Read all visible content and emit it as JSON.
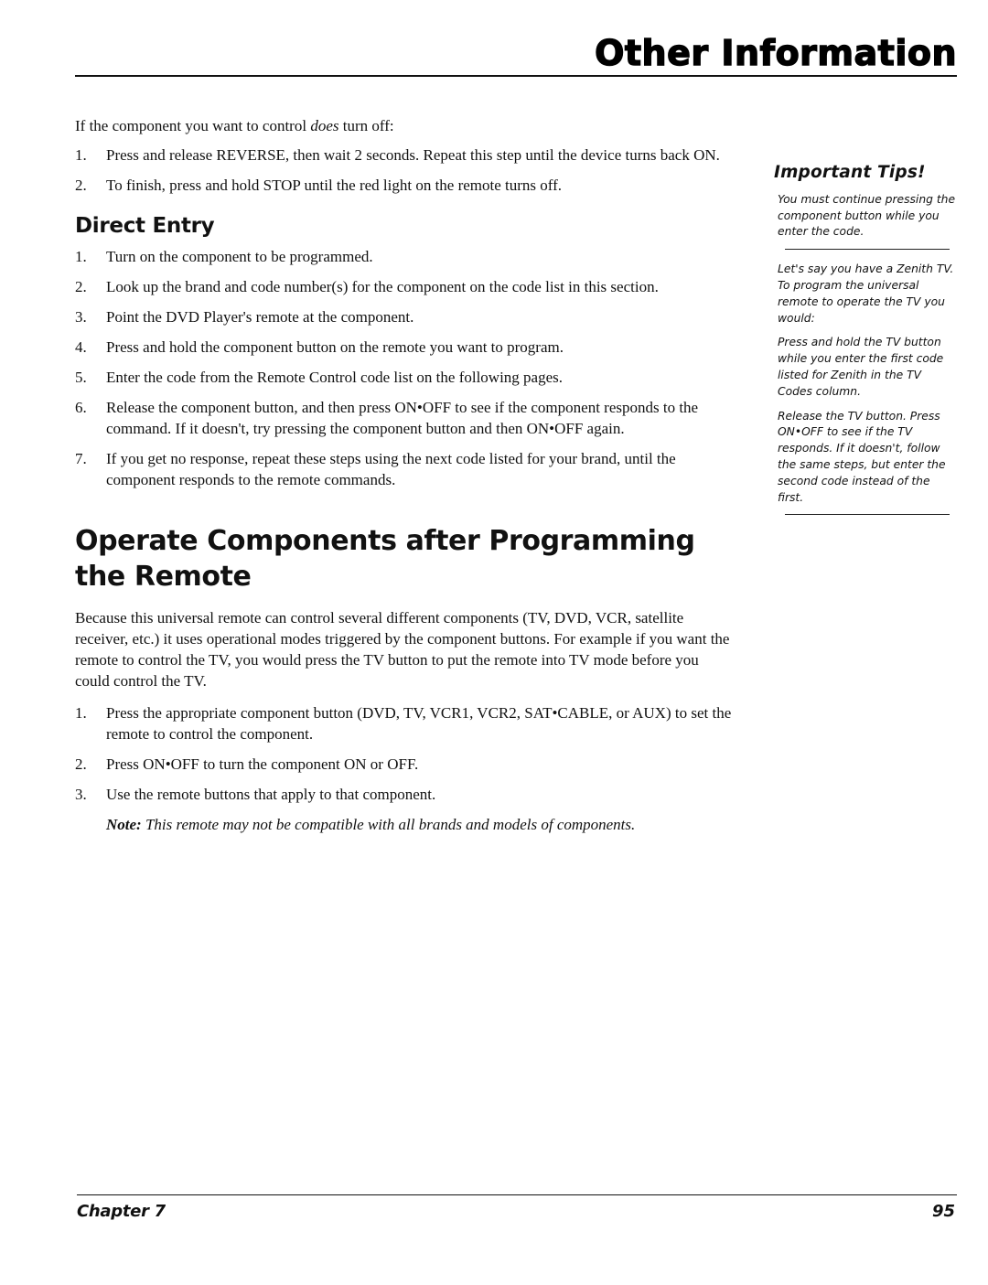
{
  "header": {
    "title": "Other Information"
  },
  "main": {
    "intro": {
      "before": "If the component you want to control ",
      "emphasis": "does",
      "after": " turn off:"
    },
    "turn_off_steps": [
      {
        "num": "1.",
        "text": "Press and release REVERSE, then wait 2 seconds. Repeat this step until the device turns back ON."
      },
      {
        "num": "2.",
        "text": "To finish, press and hold STOP until the red light on the remote turns off."
      }
    ],
    "direct_entry": {
      "heading": "Direct Entry",
      "steps": [
        {
          "num": "1.",
          "text": "Turn on the component to be programmed."
        },
        {
          "num": "2.",
          "text": "Look up the brand and code number(s) for the component on the code list in this section."
        },
        {
          "num": "3.",
          "text": "Point the DVD Player's remote at the component."
        },
        {
          "num": "4.",
          "text": "Press and hold the component button on the remote you want to program."
        },
        {
          "num": "5.",
          "text": "Enter the code from the Remote Control code list on the following pages."
        },
        {
          "num": "6.",
          "text": "Release the component button, and then press ON•OFF to see if the component responds to the command. If it doesn't, try pressing the component button and then ON•OFF again."
        },
        {
          "num": "7.",
          "text": "If you get no response, repeat these steps using the next code listed for your brand, until the component responds to the remote commands."
        }
      ]
    },
    "operate": {
      "heading": "Operate Components after Programming the Remote",
      "paragraph": "Because this universal remote can control several different components (TV, DVD, VCR, satellite receiver, etc.) it uses operational modes triggered by the component buttons. For example if you want the remote to control the TV, you would press the TV button to put the remote into TV mode before you could control the TV.",
      "steps": [
        {
          "num": "1.",
          "text": "Press the appropriate component button (DVD, TV, VCR1, VCR2, SAT•CABLE, or AUX) to set the remote to control the component."
        },
        {
          "num": "2.",
          "text": "Press ON•OFF to turn the component ON or OFF."
        },
        {
          "num": "3.",
          "text": "Use the remote buttons that apply to that component."
        }
      ],
      "note_label": "Note:",
      "note_text": " This remote may not be compatible with all brands and models of components."
    }
  },
  "sidebar": {
    "title": "Important Tips!",
    "tip1": "You must continue pressing the component button while you enter the code.",
    "example_intro": "Let's say you have a Zenith TV. To program the universal remote to operate the TV you would:",
    "example_step1": "Press and hold the TV button while you enter the first code listed for Zenith in the TV Codes column.",
    "example_step2": "Release the TV button. Press ON•OFF to see if the TV responds. If it doesn't, follow the same steps, but enter the second code instead of the first."
  },
  "footer": {
    "chapter": "Chapter 7",
    "page": "95"
  }
}
